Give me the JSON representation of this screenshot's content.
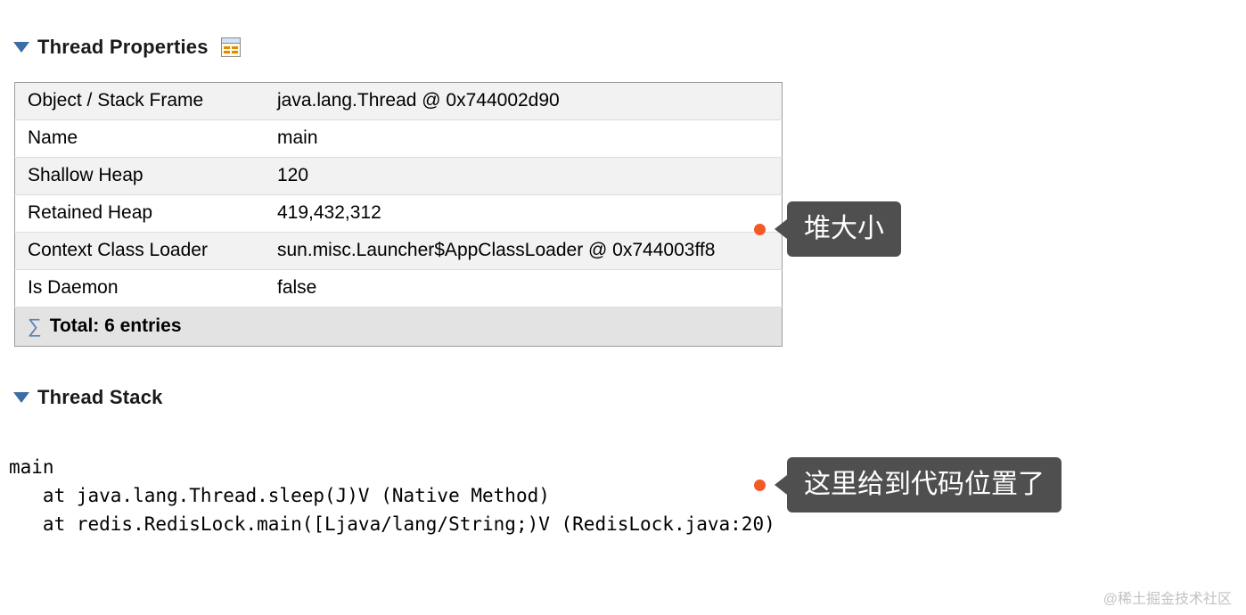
{
  "sections": {
    "properties_title": "Thread Properties",
    "stack_title": "Thread Stack"
  },
  "table": {
    "rows": [
      {
        "key": "Object / Stack Frame",
        "value": "java.lang.Thread @ 0x744002d90"
      },
      {
        "key": "Name",
        "value": "main"
      },
      {
        "key": "Shallow Heap",
        "value": "120"
      },
      {
        "key": "Retained Heap",
        "value": "419,432,312"
      },
      {
        "key": "Context Class Loader",
        "value": "sun.misc.Launcher$AppClassLoader @ 0x744003ff8"
      },
      {
        "key": "Is Daemon",
        "value": "false"
      }
    ],
    "total_label": "Total: 6 entries"
  },
  "stack": {
    "line0": "main",
    "line1": "   at java.lang.Thread.sleep(J)V (Native Method)",
    "line2": "   at redis.RedisLock.main([Ljava/lang/String;)V (RedisLock.java:20)"
  },
  "callouts": {
    "heap": "堆大小",
    "code_loc": "这里给到代码位置了"
  },
  "watermark": "@稀土掘金技术社区"
}
